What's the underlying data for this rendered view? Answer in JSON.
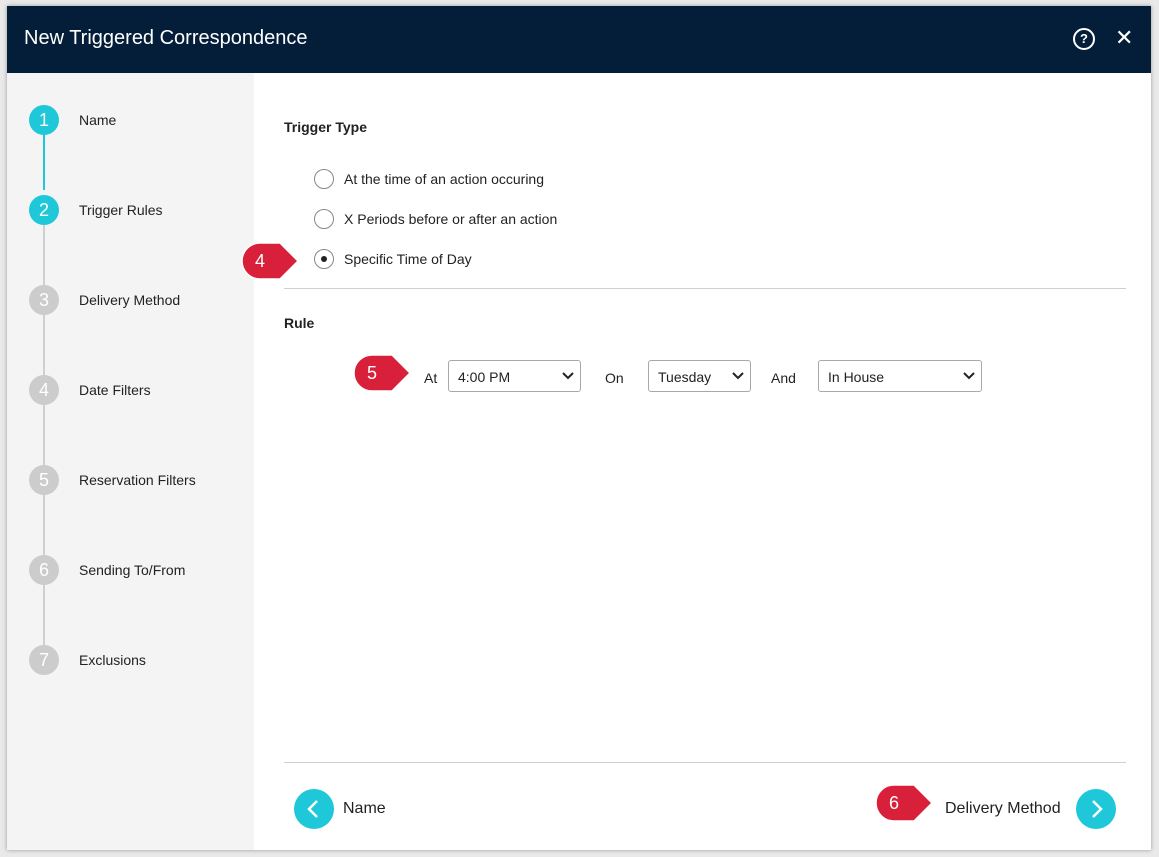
{
  "window": {
    "title": "New Triggered Correspondence",
    "help_icon": "?",
    "close_icon": "✕"
  },
  "sidebar": {
    "steps": [
      {
        "num": "1",
        "label": "Name",
        "state": "done"
      },
      {
        "num": "2",
        "label": "Trigger Rules",
        "state": "active"
      },
      {
        "num": "3",
        "label": "Delivery Method",
        "state": "pending"
      },
      {
        "num": "4",
        "label": "Date Filters",
        "state": "pending"
      },
      {
        "num": "5",
        "label": "Reservation Filters",
        "state": "pending"
      },
      {
        "num": "6",
        "label": "Sending To/From",
        "state": "pending"
      },
      {
        "num": "7",
        "label": "Exclusions",
        "state": "pending"
      }
    ]
  },
  "trigger": {
    "heading": "Trigger Type",
    "options": [
      {
        "label": "At the time of an action occuring",
        "selected": false
      },
      {
        "label": "X Periods before or after an action",
        "selected": false
      },
      {
        "label": "Specific Time of Day",
        "selected": true
      }
    ]
  },
  "rule": {
    "heading": "Rule",
    "at_label": "At",
    "at_value": "4:00 PM",
    "on_label": "On",
    "on_value": "Tuesday",
    "and_label": "And",
    "and_value": "In House"
  },
  "footer": {
    "back_label": "Name",
    "next_label": "Delivery Method"
  },
  "callouts": {
    "c4": "4",
    "c5": "5",
    "c6": "6"
  },
  "colors": {
    "accent": "#1ec8d8",
    "header": "#041e3a",
    "callout": "#d9203a",
    "inactive_step": "#cccccc"
  }
}
